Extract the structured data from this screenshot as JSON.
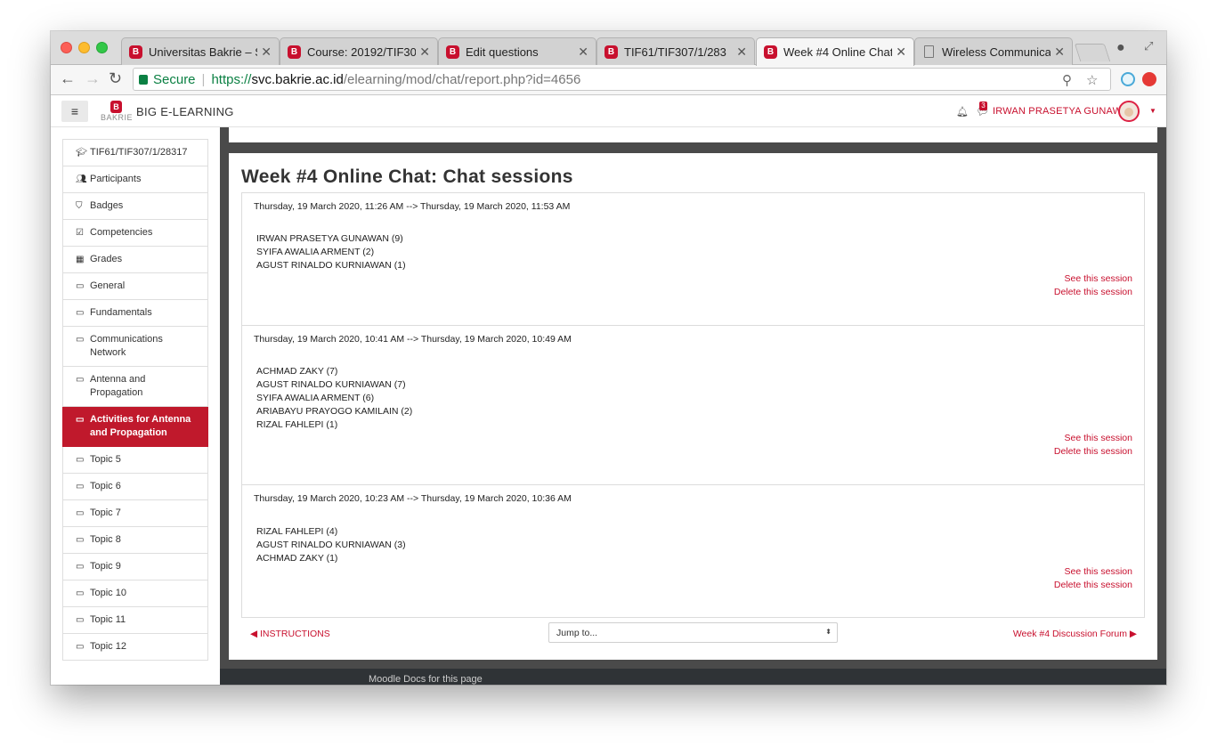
{
  "browser": {
    "tabs": [
      {
        "title": "Universitas Bakrie – S",
        "favicon": "bakrie-logo-icon"
      },
      {
        "title": "Course: 20192/TIF30",
        "favicon": "bakrie-logo-icon"
      },
      {
        "title": "Edit questions",
        "favicon": "bakrie-logo-icon"
      },
      {
        "title": "TIF61/TIF307/1/283",
        "favicon": "bakrie-logo-icon"
      },
      {
        "title": "Week #4 Online Chat",
        "favicon": "bakrie-logo-icon"
      },
      {
        "title": "Wireless Communicat",
        "favicon": "document-icon"
      }
    ],
    "secure_label": "Secure",
    "url_scheme": "https://",
    "url_host": "svc.bakrie.ac.id",
    "url_path": "/elearning/mod/chat/report.php?id=4656"
  },
  "navbar": {
    "logo_text": "BAKRIE",
    "brand": "BIG E-LEARNING",
    "message_count": "3",
    "user_name": "IRWAN PRASETYA GUNAWAN"
  },
  "sidebar": {
    "items": [
      {
        "label": "TIF61/TIF307/1/28317",
        "icon": "graduation-cap-icon"
      },
      {
        "label": "Participants",
        "icon": "users-icon"
      },
      {
        "label": "Badges",
        "icon": "shield-icon"
      },
      {
        "label": "Competencies",
        "icon": "check-square-icon"
      },
      {
        "label": "Grades",
        "icon": "table-icon"
      },
      {
        "label": "General",
        "icon": "folder-icon"
      },
      {
        "label": "Fundamentals",
        "icon": "folder-icon"
      },
      {
        "label": "Communications Network",
        "icon": "folder-icon"
      },
      {
        "label": "Antenna and Propagation",
        "icon": "folder-icon"
      },
      {
        "label": "Activities for Antenna and Propagation",
        "icon": "folder-icon"
      },
      {
        "label": "Topic 5",
        "icon": "folder-icon"
      },
      {
        "label": "Topic 6",
        "icon": "folder-icon"
      },
      {
        "label": "Topic 7",
        "icon": "folder-icon"
      },
      {
        "label": "Topic 8",
        "icon": "folder-icon"
      },
      {
        "label": "Topic 9",
        "icon": "folder-icon"
      },
      {
        "label": "Topic 10",
        "icon": "folder-icon"
      },
      {
        "label": "Topic 11",
        "icon": "folder-icon"
      },
      {
        "label": "Topic 12",
        "icon": "folder-icon"
      }
    ]
  },
  "main": {
    "title": "Week #4 Online Chat: Chat sessions",
    "sessions": [
      {
        "range": "Thursday, 19 March 2020, 11:26 AM --> Thursday, 19 March 2020, 11:53 AM",
        "participants": [
          "IRWAN PRASETYA GUNAWAN (9)",
          "SYIFA AWALIA ARMENT (2)",
          "AGUST RINALDO KURNIAWAN (1)"
        ],
        "see_label": "See this session",
        "delete_label": "Delete this session"
      },
      {
        "range": "Thursday, 19 March 2020, 10:41 AM --> Thursday, 19 March 2020, 10:49 AM",
        "participants": [
          "ACHMAD ZAKY (7)",
          "AGUST RINALDO KURNIAWAN (7)",
          "SYIFA AWALIA ARMENT (6)",
          "ARIABAYU PRAYOGO KAMILAIN (2)",
          "RIZAL FAHLEPI (1)"
        ],
        "see_label": "See this session",
        "delete_label": "Delete this session"
      },
      {
        "range": "Thursday, 19 March 2020, 10:23 AM --> Thursday, 19 March 2020, 10:36 AM",
        "participants": [
          "RIZAL FAHLEPI (4)",
          "AGUST RINALDO KURNIAWAN (3)",
          "ACHMAD ZAKY (1)"
        ],
        "see_label": "See this session",
        "delete_label": "Delete this session"
      }
    ],
    "prev_link": "INSTRUCTIONS",
    "jump_placeholder": "Jump to...",
    "next_link": "Week #4 Discussion Forum"
  },
  "footer": {
    "text": "Moodle Docs for this page"
  },
  "colors": {
    "accent": "#c8102e",
    "sidebar_active": "#c0192c",
    "gutter": "#4a4a4a"
  }
}
